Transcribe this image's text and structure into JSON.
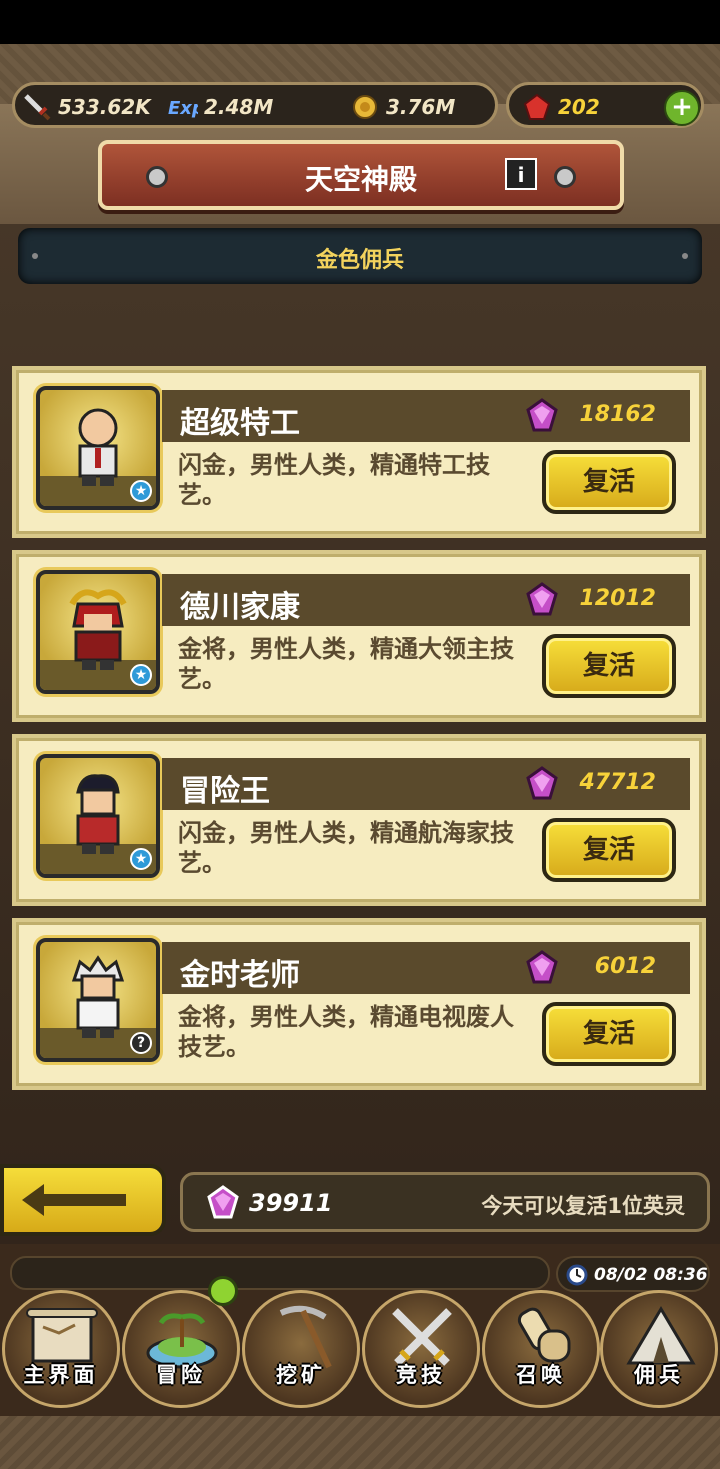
{
  "resources": {
    "attack": "533.62K",
    "exp": "2.48M",
    "gold": "3.76M",
    "gems": "202"
  },
  "colors": {
    "gold_text": "#f7d23a",
    "button_yellow": "#f0cf2a",
    "card_bg": "#f6ecc0",
    "banner_red": "#9a4331"
  },
  "title": "天空神殿",
  "category": "金色佣兵",
  "mercenaries": [
    {
      "name": "超级特工",
      "cost": "18162",
      "desc": "闪金，男性人类，精通特工技艺。",
      "button": "复活",
      "badge": "star"
    },
    {
      "name": "德川家康",
      "cost": "12012",
      "desc": "金将，男性人类，精通大领主技艺。",
      "button": "复活",
      "badge": "star"
    },
    {
      "name": "冒险王",
      "cost": "47712",
      "desc": "闪金，男性人类，精通航海家技艺。",
      "button": "复活",
      "badge": "star"
    },
    {
      "name": "金时老师",
      "cost": "6012",
      "desc": "金将，男性人类，精通电视废人技艺。",
      "button": "复活",
      "badge": "question"
    }
  ],
  "footer": {
    "balance": "39911",
    "note": "今天可以复活1位英灵",
    "datetime": "08/02 08:36"
  },
  "nav": [
    {
      "label": "主界面",
      "icon": "map-scroll-icon"
    },
    {
      "label": "冒险",
      "icon": "island-icon"
    },
    {
      "label": "挖矿",
      "icon": "pickaxe-icon"
    },
    {
      "label": "竞技",
      "icon": "crossed-swords-icon"
    },
    {
      "label": "召唤",
      "icon": "summon-scroll-icon"
    },
    {
      "label": "佣兵",
      "icon": "tent-icon"
    }
  ]
}
